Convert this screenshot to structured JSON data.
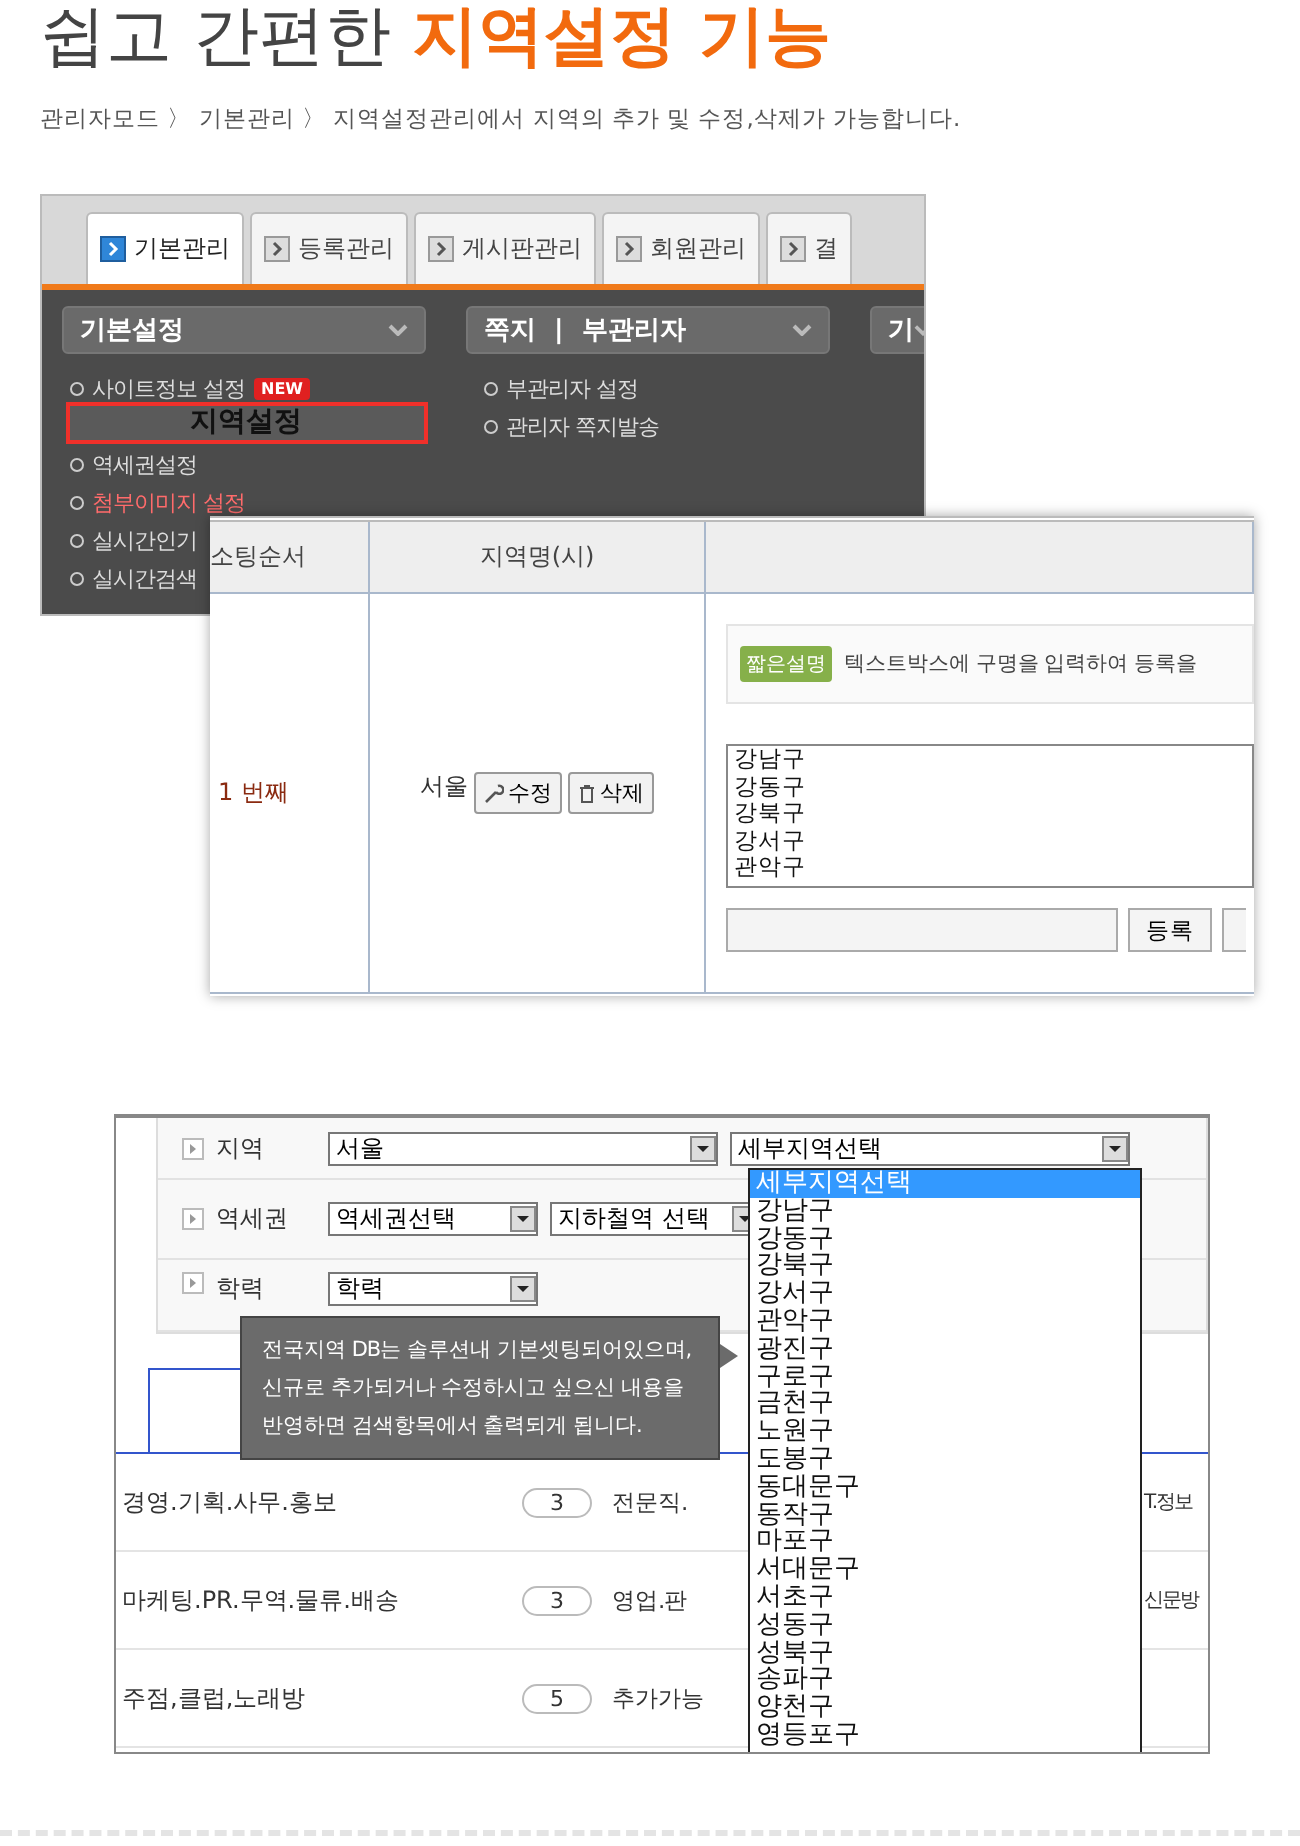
{
  "heading": {
    "plain": "쉽고 간편한",
    "highlight": "지역설정 기능"
  },
  "subtitle": "관리자모드 〉 기본관리 〉 지역설정관리에서 지역의 추가 및 수정,삭제가 가능합니다.",
  "admin_screen": {
    "tabs": [
      {
        "label": "기본관리",
        "selected": true
      },
      {
        "label": "등록관리",
        "selected": false
      },
      {
        "label": "게시판관리",
        "selected": false
      },
      {
        "label": "회원관리",
        "selected": false
      },
      {
        "label": "결",
        "selected": false
      }
    ],
    "menu_bars": [
      "기본설정",
      "쪽지  |  부관리자",
      "기"
    ],
    "menu_col_1": [
      {
        "label": "사이트정보 설정",
        "badge": "NEW",
        "highlight": false
      },
      {
        "label": "역세권설정",
        "highlight": false
      },
      {
        "label": "첨부이미지 설정",
        "highlight": true
      },
      {
        "label": "실시간인기",
        "highlight": false
      },
      {
        "label": "실시간검색",
        "highlight": false
      }
    ],
    "menu_col_2": [
      "부관리자 설정",
      "관리자 쪽지발송"
    ],
    "callout": "지역설정"
  },
  "region_table": {
    "columns": [
      "소팅순서",
      "지역명(시)"
    ],
    "row": {
      "order": "1 번째",
      "city": "서울",
      "edit_button": "수정",
      "delete_button": "삭제",
      "hint_badge": "짧은설명",
      "hint": "텍스트박스에 구명을 입력하여 등록을",
      "districts": [
        "강남구",
        "강동구",
        "강북구",
        "강서구",
        "관악구"
      ],
      "add_button": "등록"
    }
  },
  "search_screen": {
    "fields": [
      {
        "label": "지역",
        "select": "서울",
        "select_2": "세부지역선택"
      },
      {
        "label": "역세권",
        "select": "역세권선택",
        "select_2": "지하철역 선택"
      },
      {
        "label": "학력",
        "select": "학력"
      }
    ],
    "tooltip": [
      "전국지역 DB는 솔루션내 기본셋팅되어있으며,",
      "신규로 추가되거나 수정하시고 싶으신 내용을",
      "반영하면 검색항목에서 출력되게 됩니다."
    ],
    "categories": [
      {
        "name": "경영.기획.사무.홍보",
        "count": "3",
        "col_2": "전문직.",
        "col_3": "T.정보"
      },
      {
        "name": "마케팅.PR.무역.물류.배송",
        "count": "3",
        "col_2": "영업.판",
        "col_3": "신문방"
      },
      {
        "name": "주점,클럽,노래방",
        "count": "5",
        "col_2": "추가가능"
      }
    ],
    "district_options": [
      {
        "label": "세부지역선택",
        "selected": true
      },
      {
        "label": "강남구",
        "selected": false
      },
      {
        "label": "강동구",
        "selected": false
      },
      {
        "label": "강북구",
        "selected": false
      },
      {
        "label": "강서구",
        "selected": false
      },
      {
        "label": "관악구",
        "selected": false
      },
      {
        "label": "광진구",
        "selected": false
      },
      {
        "label": "구로구",
        "selected": false
      },
      {
        "label": "금천구",
        "selected": false
      },
      {
        "label": "노원구",
        "selected": false
      },
      {
        "label": "도봉구",
        "selected": false
      },
      {
        "label": "동대문구",
        "selected": false
      },
      {
        "label": "동작구",
        "selected": false
      },
      {
        "label": "마포구",
        "selected": false
      },
      {
        "label": "서대문구",
        "selected": false
      },
      {
        "label": "서초구",
        "selected": false
      },
      {
        "label": "성동구",
        "selected": false
      },
      {
        "label": "성북구",
        "selected": false
      },
      {
        "label": "송파구",
        "selected": false
      },
      {
        "label": "양천구",
        "selected": false
      },
      {
        "label": "영등포구",
        "selected": false
      }
    ]
  }
}
